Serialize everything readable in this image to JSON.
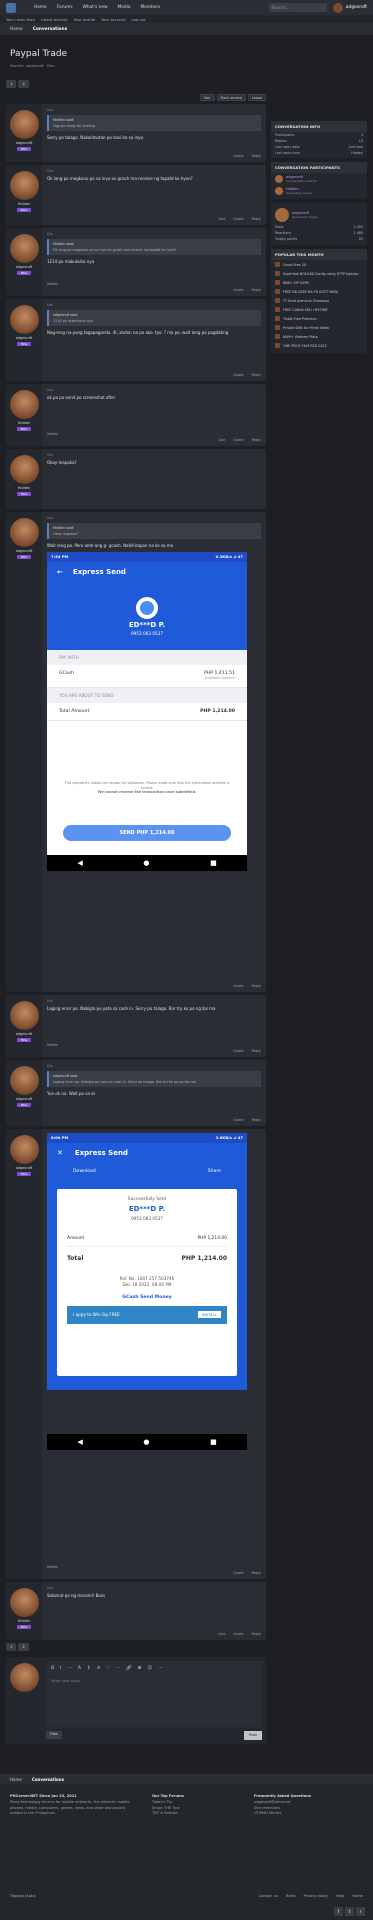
{
  "topnav": {
    "items": [
      "Home",
      "Forums",
      "What's new",
      "Media",
      "Members"
    ],
    "search_placeholder": "Search...",
    "username": "adgesroft"
  },
  "subnav": [
    "Your news feed",
    "Latest activity",
    "Your profile",
    "Your account",
    "Log out"
  ],
  "breadcrumb": [
    "Home",
    "Conversations"
  ],
  "thread": {
    "title": "Paypal Trade",
    "meta": "Starter: adgesroft · Dec"
  },
  "pager": {
    "pages": [
      "1",
      "2"
    ],
    "actions": [
      "Star",
      "Mark unread",
      "Leave"
    ]
  },
  "posts": [
    {
      "user": "adgesroft",
      "tag": "Elite",
      "date": "Dec",
      "quote_author": "Hidden said:",
      "quote": "Ugg po ready for trading",
      "text": "Sorry po talaga. Nakalimutan po kasi ito sa inyo.",
      "reply": "Quote",
      "rep": "Reply"
    },
    {
      "user": "Hidden",
      "tag": "Elite",
      "date": "Dec",
      "text": "Ok lang po magkano po sa inyo as gcash ma-receive ng tapatd ko hyon?",
      "like": "Like",
      "quote": "Quote",
      "reply": "Reply"
    },
    {
      "user": "adgesroft",
      "tag": "Elite",
      "date": "Dec",
      "quote_author": "Hidden said:",
      "quote": "Ok lang po magkano po sa inyo sa gcash ma-receive ng tapatd ko hyon?",
      "text": "1214 po makukuha nya",
      "reaction": "Hidden",
      "quote_lbl": "Quote",
      "reply": "Reply"
    },
    {
      "user": "adgesroft",
      "tag": "Elite",
      "date": "Dec",
      "quote_author": "adgesroft said:",
      "quote": "1214 po makukuha nya",
      "text": "Nag-msg na-yung tagapaganda. 4l, andun na po ako. tyo. ? nia po, wait lang po pagdating",
      "quote_lbl": "Quote",
      "reply": "Reply"
    },
    {
      "user": "Hidden",
      "tag": "Elite",
      "date": "Dec",
      "text": "ok po po send po screenshot after",
      "reaction": "Hidden",
      "like": "Like",
      "quote": "Quote",
      "reply": "Reply"
    },
    {
      "user": "Hidden",
      "tag": "Elite",
      "date": "Dec",
      "text": "Okay mapaka?"
    },
    {
      "user": "adgesroft",
      "tag": "Elite",
      "date": "Dec",
      "quote_author": "Hidden said:",
      "quote": "Okay mapaka?",
      "text": "Wait lang po. Pero ante ang g- gcash. Nahihirapan na ko sa mo",
      "quote_lbl": "Quote",
      "reply": "Reply"
    },
    {
      "user": "adgesroft",
      "tag": "Elite",
      "date": "Dec",
      "text": "Laging error po. Nabigla po yata sa cash in. Sorry po talaga. Bar try ko po ng ibs ma",
      "reaction": "Hidden",
      "quote_lbl": "Quote",
      "reply": "Reply"
    },
    {
      "user": "adgesroft",
      "tag": "Elite",
      "date": "Dec",
      "quote_author": "adgesroft said:",
      "quote": "Laging error po. Nabigla po yata sa cash in. Sorry po talaga. Bar try ko po ng ibs ma",
      "text": "Yun ok na. Wait po sa ss",
      "quote_lbl": "Quote",
      "reply": "Reply"
    },
    {
      "user": "adgesroft",
      "tag": "Elite",
      "date": "Dec",
      "reaction": "Hidden",
      "quote_lbl": "Quote",
      "reply": "Reply"
    },
    {
      "user": "Hidden",
      "tag": "Elite",
      "date": "Dec",
      "text": "Salamat po ng marami! Boss",
      "like": "Like",
      "quote": "Quote",
      "reply": "Reply"
    }
  ],
  "ss1": {
    "time": "7:54 PM",
    "status": "0.3KB/s ⊿ 47",
    "title": "Express Send",
    "name": "ED***D P.",
    "number": "0953 083 0537",
    "pay_with": "PAY WITH",
    "method": "GCash",
    "method_amt": "PHP 1,411.51",
    "available": "Available Balance",
    "about": "YOU ARE ABOUT TO SEND",
    "amount_lbl": "Total Amount",
    "amount": "PHP 1,214.00",
    "note1": "The recipient's initials are shown for validation. Please make sure that the information entered is correct.",
    "note2": "We cannot reverse the transaction once submitted.",
    "button": "SEND PHP 1,214.00"
  },
  "ss2": {
    "time": "8:00 PM",
    "status": "3.6KB/s ⊿ 47",
    "title": "Express Send",
    "download": "Download",
    "share": "Share",
    "success": "Successfully Sent",
    "name": "ED***D P.",
    "number": "0953 083 0537",
    "amount_lbl": "Amount",
    "amount": "PHP 1,214.00",
    "total_lbl": "Total",
    "total": "PHP 1,214.00",
    "ref": "Ref. No. 1007 257 503746",
    "date": "Dec 18 2022, 08:00 PM",
    "gcash": "GCash Send Money",
    "ad": "I appy to Win Gg  FREE",
    "ad_btn": "INSTALL"
  },
  "editor": {
    "tools": [
      "B",
      "I",
      "⋯",
      "A",
      "↕",
      "≡",
      "∷",
      "⋯",
      "🔗",
      "⊞",
      "☺",
      "⋯"
    ],
    "placeholder": "Write your reply...",
    "files": "Files",
    "post": "Post"
  },
  "sidebar": {
    "info_title": "CONVERSATION INFO",
    "info": [
      [
        "Participants",
        "3"
      ],
      [
        "Replies",
        "10"
      ],
      [
        "Last reply date",
        "Just now"
      ],
      [
        "Last reply from",
        "Hidden"
      ]
    ],
    "part_title": "CONVERSATION PARTICIPANTS",
    "participants": [
      {
        "name": "adgesroft",
        "role": "Conversation starter"
      },
      {
        "name": "Hidden",
        "role": "Secondary Hyper"
      }
    ],
    "profile": {
      "name": "adgesroft",
      "role": "Secondary Hyper",
      "rows": [
        [
          "Posts",
          "2,450"
        ],
        [
          "Reactions",
          "1,980"
        ],
        [
          "Trophy points",
          "83"
        ]
      ]
    },
    "popular_title": "POPULAR THIS MONTH",
    "popular": [
      "Gmail Free 2G",
      "Superfast NOLOAD Config using HTTP Injector",
      "BBB+ VIP (UHP)",
      "FREE BB USER NA FB GOST MAYA",
      "TT Hunt premium Giveaway",
      "FREE CANVA EDU LIFETIME",
      "Tiktok Free Premium",
      "Private DNS for Prime Video",
      "NW9+ Vietnam Piata",
      "ONE PIECE FILM RED 2022"
    ]
  },
  "footer": {
    "crumb": [
      "Home",
      "Conversations"
    ],
    "col1_title": "PHCorner.NET Since Jan 23, 2011",
    "col1": "Pinoy technology forums for mobile networks, the internet, mobile phones, media, computers, games, news, and other discussions related in the Philippines.",
    "col2_title": "Our Top Forums",
    "col2": [
      "Today's Tip",
      "Smart THE Tips",
      "TNT & Refresh"
    ],
    "col3_title": "Frequently Asked Questions",
    "col3": [
      "adgesroft@phcorner",
      "Site reminders",
      "UTMMD Mirrors"
    ],
    "bottom_left": "Tagalog (Auto)",
    "bottom_links": [
      "Contact us",
      "Rules",
      "Privacy policy",
      "Help",
      "Home"
    ]
  }
}
